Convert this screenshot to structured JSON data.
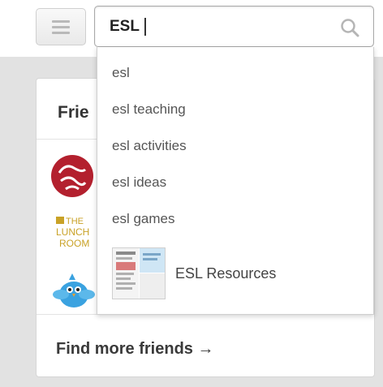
{
  "header": {
    "menu_icon": "hamburger-icon",
    "search": {
      "value": "ESL",
      "icon": "search-icon"
    }
  },
  "card": {
    "title": "Frie",
    "find_more_label": "Find more friends →",
    "avatar_2_text": [
      "THE",
      "LUNCH",
      "ROOM"
    ]
  },
  "suggestions": [
    {
      "label": "esl"
    },
    {
      "label": "esl teaching"
    },
    {
      "label": "esl activities"
    },
    {
      "label": "esl ideas"
    },
    {
      "label": "esl games"
    }
  ],
  "board_result": {
    "label": "ESL Resources"
  },
  "colors": {
    "gray_band": "#e2e2e2",
    "avatar_red": "#b3202e",
    "twitter_blue": "#3aa2e0",
    "lunch_gold": "#c9a227"
  }
}
